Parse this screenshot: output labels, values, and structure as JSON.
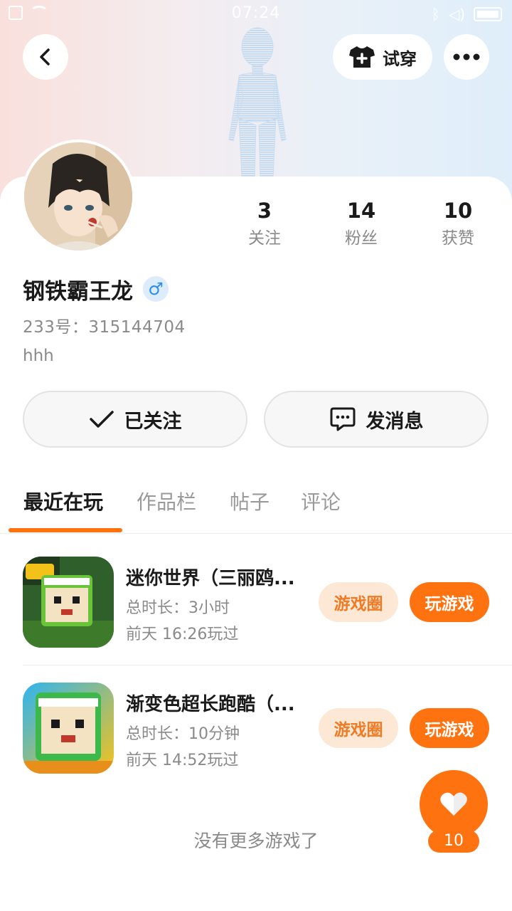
{
  "status_bar": {
    "time": "07:24"
  },
  "header": {
    "try_on_label": "试穿"
  },
  "profile": {
    "nickname": "钢铁霸王龙",
    "gender_symbol": "♂",
    "uid": "233号：315144704",
    "bio": "hhh"
  },
  "stats": [
    {
      "value": "3",
      "label": "关注"
    },
    {
      "value": "14",
      "label": "粉丝"
    },
    {
      "value": "10",
      "label": "获赞"
    }
  ],
  "actions": {
    "follow_label": "已关注",
    "message_label": "发消息"
  },
  "tabs": [
    {
      "label": "最近在玩",
      "active": true
    },
    {
      "label": "作品栏",
      "active": false
    },
    {
      "label": "帖子",
      "active": false
    },
    {
      "label": "评论",
      "active": false
    }
  ],
  "games": [
    {
      "title": "迷你世界（三丽鸥...",
      "duration": "总时长：3小时",
      "last_played": "前天 16:26玩过",
      "circle_label": "游戏圈",
      "play_label": "玩游戏"
    },
    {
      "title": "渐变色超长跑酷（...",
      "duration": "总时长：10分钟",
      "last_played": "前天 14:52玩过",
      "circle_label": "游戏圈",
      "play_label": "玩游戏"
    }
  ],
  "footer": {
    "no_more_text": "没有更多游戏了"
  },
  "like": {
    "count": "10"
  },
  "colors": {
    "accent": "#ff7210",
    "accent_soft": "#fde8d6",
    "male_blue": "#2f8ee8"
  },
  "icons": [
    "back-arrow-icon",
    "tshirt-plus-icon",
    "more-dots-icon",
    "check-icon",
    "chat-bubble-icon",
    "heart-icon"
  ]
}
